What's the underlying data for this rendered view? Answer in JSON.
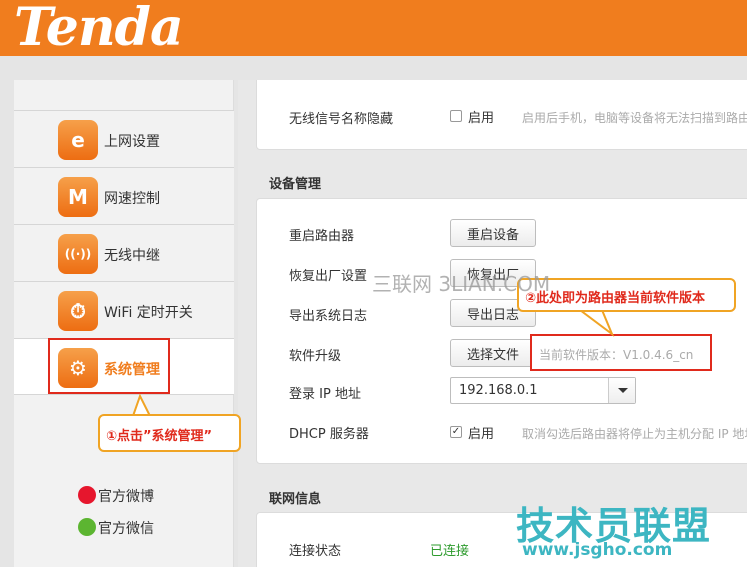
{
  "brand": {
    "logo": "Tenda"
  },
  "sidebar": {
    "items": [
      {
        "label": "上网设置",
        "icon": "internet-e-icon",
        "glyph": "e"
      },
      {
        "label": "网速控制",
        "icon": "speed-wave-icon",
        "glyph": "M"
      },
      {
        "label": "无线中继",
        "icon": "wifi-antenna-icon",
        "glyph": "((·))"
      },
      {
        "label": "WiFi 定时开关",
        "icon": "wifi-timer-icon",
        "glyph": "⏱"
      },
      {
        "label": "系统管理",
        "icon": "settings-gear-icon",
        "glyph": "⚙",
        "active": true
      }
    ],
    "social": [
      {
        "label": "官方微博",
        "icon": "weibo-icon",
        "color": "#e6162d"
      },
      {
        "label": "官方微信",
        "icon": "wechat-icon",
        "color": "#5cb531"
      }
    ]
  },
  "main": {
    "wireless_row": {
      "label": "无线信号名称隐藏",
      "checkbox_label": "启用",
      "hint": "启用后手机，电脑等设备将无法扫描到路由"
    },
    "device_section": {
      "title": "设备管理",
      "rows": {
        "reboot": {
          "label": "重启路由器",
          "button": "重启设备"
        },
        "reset": {
          "label": "恢复出厂设置",
          "button": "恢复出厂"
        },
        "export_log": {
          "label": "导出系统日志",
          "button": "导出日志"
        },
        "upgrade": {
          "label": "软件升级",
          "button": "选择文件",
          "version": "当前软件版本：V1.0.4.6_cn"
        },
        "login_ip": {
          "label": "登录 IP 地址",
          "value": "192.168.0.1"
        },
        "dhcp": {
          "label": "DHCP 服务器",
          "checkbox_label": "启用",
          "hint": "取消勾选后路由器将停止为主机分配 IP 地址"
        }
      }
    },
    "network_section": {
      "title": "联网信息",
      "status_label": "连接状态",
      "status_value": "已连接"
    }
  },
  "annotations": {
    "step1": "①点击”系统管理”",
    "step2": "②此处即为路由器当前软件版本"
  },
  "watermarks": {
    "site": "三联网 3LIAN.COM",
    "brand_cn": "技术员联盟",
    "url": "www.jsgho.com"
  },
  "colors": {
    "brand_orange": "#f07d1e",
    "highlight_red": "#e02a1c",
    "callout_border": "#f0a424",
    "status_green": "#2e9b2e",
    "watermark_teal": "#3db6c2"
  }
}
